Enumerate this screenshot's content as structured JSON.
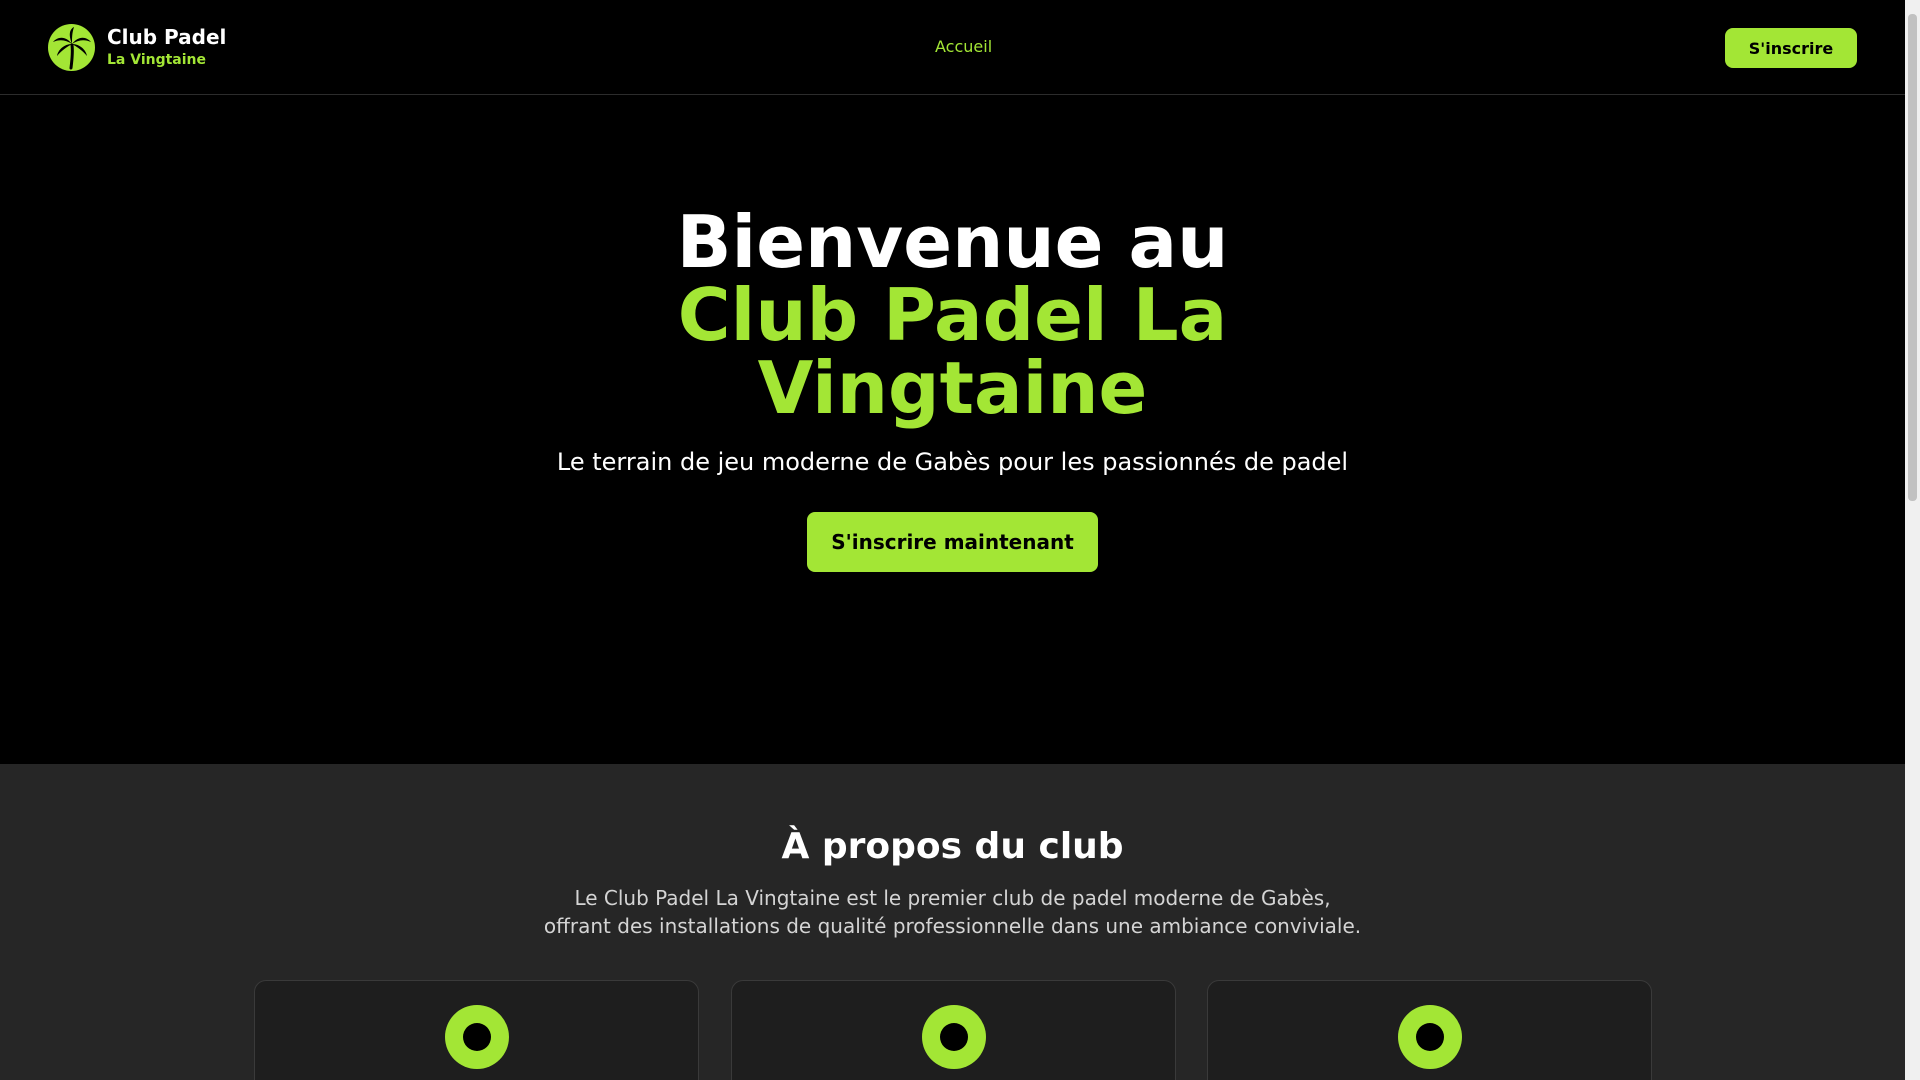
{
  "header": {
    "logo_title": "Club Padel",
    "logo_subtitle": "La Vingtaine",
    "logo_icon": "palm-tree-icon",
    "nav": [
      {
        "label": "Accueil"
      }
    ],
    "cta_label": "S'inscrire"
  },
  "hero": {
    "title_line1": "Bienvenue au",
    "title_accent": "Club Padel La Vingtaine",
    "subtitle": "Le terrain de jeu moderne de Gabès pour les passionnés de padel",
    "cta_label": "S'inscrire maintenant"
  },
  "about": {
    "title": "À propos du club",
    "description_line1": "Le Club Padel La Vingtaine est le premier club de padel moderne de Gabès,",
    "description_line2": "offrant des installations de qualité professionnelle dans une ambiance conviviale."
  },
  "colors": {
    "accent": "#a3e635",
    "background": "#000000",
    "section_background": "#262626"
  }
}
